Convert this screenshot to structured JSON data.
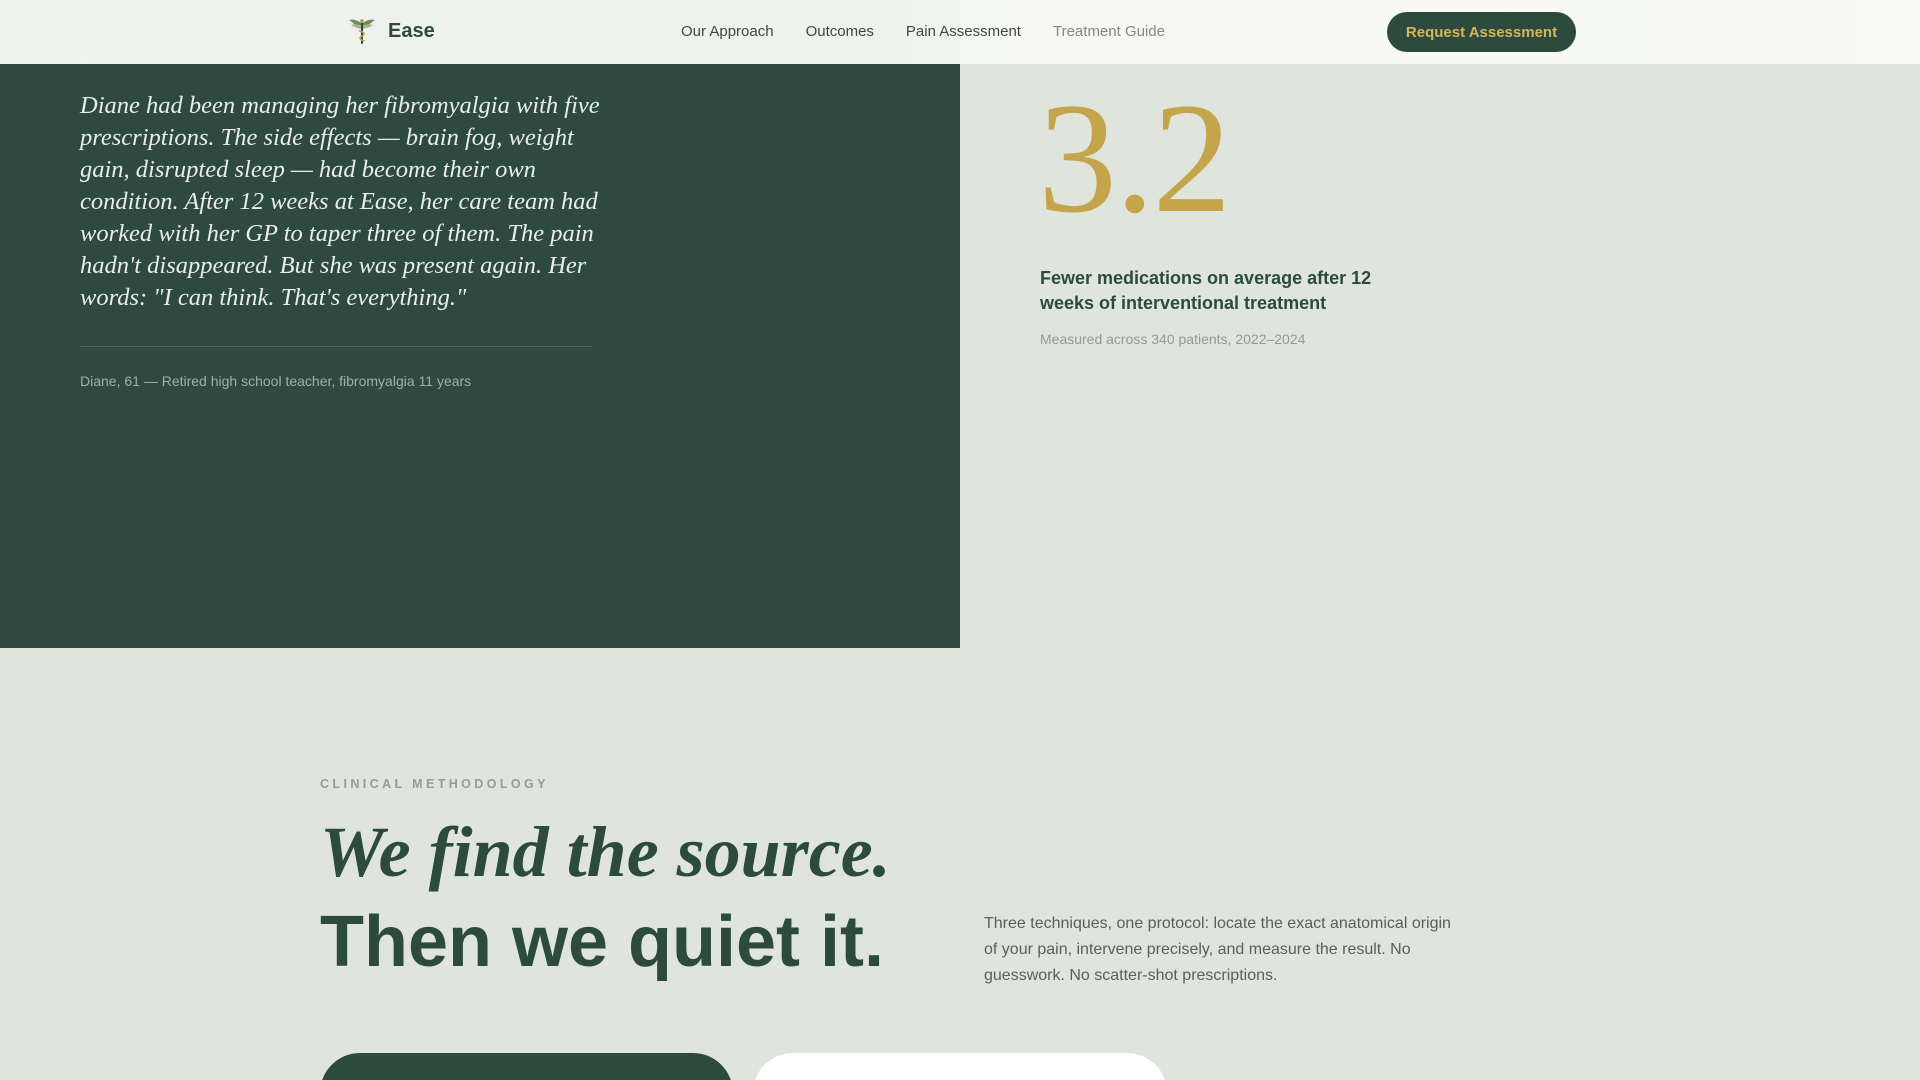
{
  "nav": {
    "brand_name": "Ease",
    "links": [
      "Our Approach",
      "Outcomes",
      "Pain Assessment",
      "Treatment Guide"
    ],
    "cta_label": "Request Assessment"
  },
  "testimonial": {
    "quote": "Diane had been managing her fibromyalgia with five prescriptions. The side effects — brain fog, weight gain, disrupted sleep — had become their own condition. After 12 weeks at Ease, her care team had worked with her GP to taper three of them. The pain hadn't disappeared. But she was present again. Her words: \"I can think. That's everything.\"",
    "attribution": "Diane, 61 — Retired high school teacher, fibromyalgia 11 years"
  },
  "stat": {
    "number": "3.2",
    "label": "Fewer medications on average after 12 weeks of interventional treatment",
    "note": "Measured across 340 patients, 2022–2024"
  },
  "methodology": {
    "eyebrow": "CLINICAL METHODOLOGY",
    "headline_italic": "We find the source.",
    "headline_bold": "Then we quiet it.",
    "intro": "Three techniques, one protocol: locate the exact anatomical origin of your pain, intervene precisely, and measure the result. No guesswork. No scatter-shot prescriptions."
  },
  "colors": {
    "forest": "#2d4a3e",
    "gold": "#c5a54b",
    "sage_bg": "#dfe5dc"
  },
  "icons": {
    "brand": "winged-caduceus-icon",
    "quote": "quote-mark-icon"
  }
}
